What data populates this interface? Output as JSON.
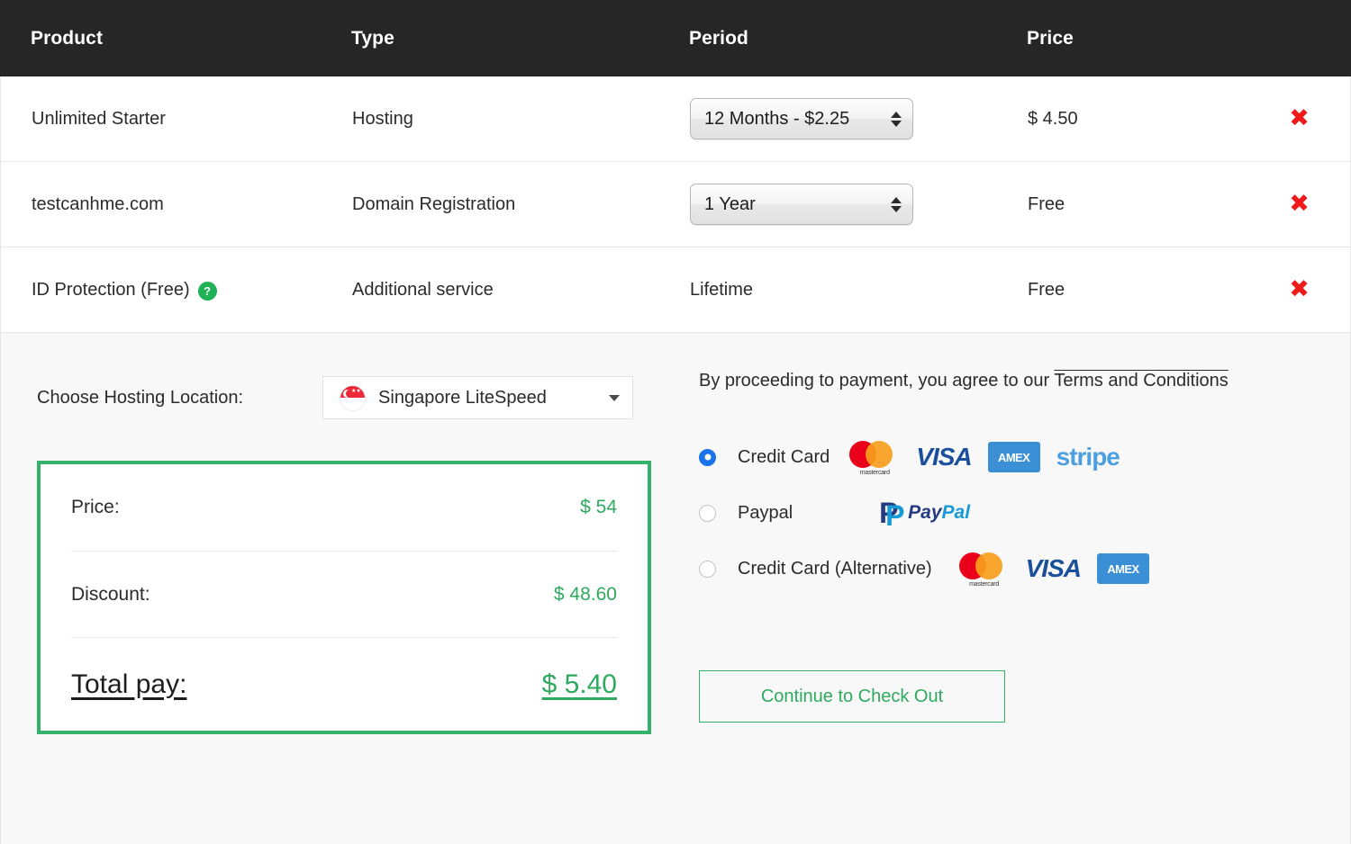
{
  "table": {
    "columns": [
      "Product",
      "Type",
      "Period",
      "Price"
    ],
    "rows": [
      {
        "product": "Unlimited Starter",
        "type": "Hosting",
        "period_value": "12 Months - $2.25",
        "period_is_select": true,
        "price": "$ 4.50",
        "remove_icon": "close-x-icon",
        "has_help": false
      },
      {
        "product": "testcanhme.com",
        "type": "Domain Registration",
        "period_value": "1 Year",
        "period_is_select": true,
        "price": "Free",
        "remove_icon": "close-x-icon",
        "has_help": false
      },
      {
        "product": "ID Protection (Free)",
        "type": "Additional service",
        "period_value": "Lifetime",
        "period_is_select": false,
        "price": "Free",
        "remove_icon": "close-x-icon",
        "has_help": true,
        "help_glyph": "?"
      }
    ]
  },
  "location": {
    "label": "Choose Hosting Location:",
    "selected": "Singapore LiteSpeed",
    "flag_icon": "singapore-flag-icon",
    "caret_icon": "chevron-down-icon"
  },
  "summary": {
    "price_label": "Price:",
    "price_value": "$ 54",
    "discount_label": "Discount:",
    "discount_value": "$ 48.60",
    "total_label": "Total pay:",
    "total_value": "$ 5.40"
  },
  "terms": {
    "prefix": "By proceeding to payment, you agree to our ",
    "link": "Terms and Conditions"
  },
  "payment": {
    "options": [
      {
        "label": "Credit Card",
        "selected": true,
        "logos": [
          "mastercard",
          "visa",
          "amex",
          "stripe"
        ]
      },
      {
        "label": "Paypal",
        "selected": false,
        "logos": [
          "paypal"
        ]
      },
      {
        "label": "Credit Card (Alternative)",
        "selected": false,
        "logos": [
          "mastercard",
          "visa",
          "amex"
        ]
      }
    ],
    "logo_text": {
      "mastercard": "mastercard",
      "visa": "VISA",
      "amex": "AMEX",
      "stripe": "stripe",
      "paypal_pay": "Pay",
      "paypal_pal": "Pal"
    }
  },
  "checkout": {
    "label": "Continue to Check Out"
  },
  "colors": {
    "header_bg": "#262626",
    "accent_green": "#2eaa5e",
    "border_green": "#35b26a",
    "remove_red": "#ef1b1b",
    "radio_blue": "#1a73e8",
    "panel_bg": "#f8f8f8"
  }
}
